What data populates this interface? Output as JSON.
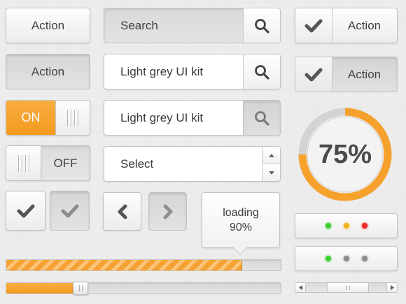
{
  "buttons": {
    "action_1": "Action",
    "action_2": "Action",
    "action_check_1": "Action",
    "action_check_2": "Action"
  },
  "search": {
    "search_box_label": "Search",
    "field_1_value": "Light grey UI kit",
    "field_2_value": "Light grey UI kit"
  },
  "toggles": {
    "on_label": "ON",
    "off_label": "OFF"
  },
  "select": {
    "selected": "Select"
  },
  "tooltip": {
    "line1": "loading",
    "line2": "90%"
  },
  "progress_ring": {
    "label": "75%",
    "value": 0.75
  },
  "progress_bar": {
    "value": 0.86
  },
  "slider": {
    "value": 0.27
  },
  "scrollbar": {
    "position": 0.55
  },
  "status_lights": {
    "row1": [
      "#3ecf2c",
      "#f5b21c",
      "#ee2a2a"
    ],
    "row2": [
      "#3ecf2c",
      "#8c8c8c",
      "#8c8c8c"
    ]
  },
  "colors": {
    "accent": "#f7a12d",
    "ring_track": "#d4d4d4"
  },
  "icons": {
    "search": "search-icon",
    "check": "checkmark-icon",
    "prev": "chevron-left-icon",
    "next": "chevron-right-icon"
  }
}
